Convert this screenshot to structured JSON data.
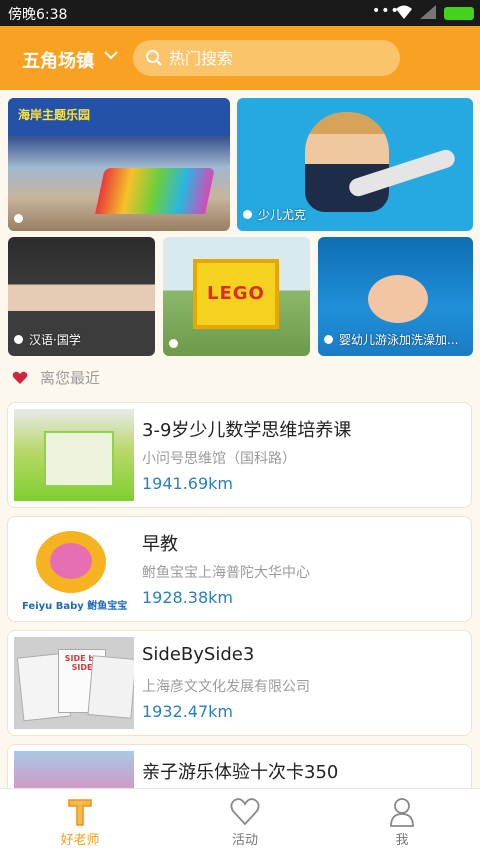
{
  "status_bar": {
    "time": "傍晚6:38"
  },
  "header": {
    "location": "五角场镇",
    "search_placeholder": "热门搜索"
  },
  "banners": [
    {
      "caption": "",
      "sign_text": "海岸主题乐园"
    },
    {
      "caption": "少儿尤克"
    },
    {
      "caption": "汉语·国学"
    },
    {
      "caption": "",
      "board_text": "LEGO"
    },
    {
      "caption": "婴幼儿游泳加洗澡加..."
    }
  ],
  "nearby": {
    "title": "离您最近",
    "items": [
      {
        "name": "3-9岁少儿数学思维培养课",
        "org": "小问号思维馆（国科路）",
        "distance": "1941.69km"
      },
      {
        "name": "早教",
        "org": "鲋鱼宝宝上海普陀大华中心",
        "distance": "1928.38km",
        "thumb_text": "Feiyu Baby 鲋鱼宝宝"
      },
      {
        "name": "SideBySide3",
        "org": "上海彦文文化发展有限公司",
        "distance": "1932.47km",
        "thumb_text": "SIDE by SIDE"
      },
      {
        "name": "亲子游乐体验十次卡350",
        "org": "",
        "distance": ""
      }
    ]
  },
  "tabs": [
    {
      "label": "好老师",
      "icon": "teacher-t-icon",
      "active": true
    },
    {
      "label": "活动",
      "icon": "heart-icon",
      "active": false
    },
    {
      "label": "我",
      "icon": "person-icon",
      "active": false
    }
  ],
  "colors": {
    "accent": "#f9a123",
    "distance": "#2a7fbf",
    "active_tab": "#f39f1b"
  }
}
